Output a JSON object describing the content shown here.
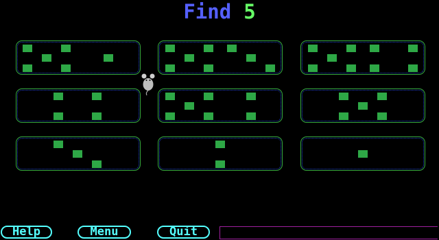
{
  "header": {
    "prompt": "Find",
    "target": "5"
  },
  "cards": [
    {
      "id": "r1c1",
      "count": 6
    },
    {
      "id": "r1c2",
      "count": 8
    },
    {
      "id": "r1c3",
      "count": 8
    },
    {
      "id": "r2c1",
      "count": 4
    },
    {
      "id": "r2c2",
      "count": 7
    },
    {
      "id": "r2c3",
      "count": 5
    },
    {
      "id": "r3c1",
      "count": 3
    },
    {
      "id": "r3c2",
      "count": 2
    },
    {
      "id": "r3c3",
      "count": 1
    }
  ],
  "toolbar": {
    "help_label": "Help",
    "menu_label": "Menu",
    "quit_label": "Quit",
    "message": ""
  },
  "colors": {
    "title": "#5560ff",
    "target": "#66ff66",
    "dot": "#2ea846",
    "card_border": "#36a83e",
    "button": "#55ffff",
    "message_border": "#a020a0"
  },
  "cursor": {
    "icon": "mouse-icon"
  }
}
